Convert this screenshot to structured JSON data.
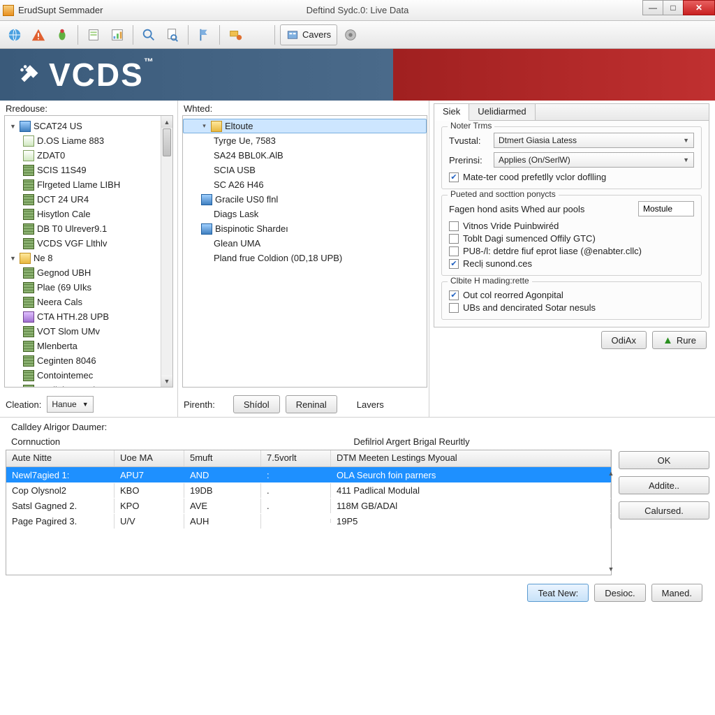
{
  "window": {
    "title_left": "ErudSupt Semmader",
    "title_center": "Deftind Sydc.0: Live Data"
  },
  "toolbar": {
    "cavers_label": "Cavers"
  },
  "banner": {
    "logo_text": "VCDS",
    "tm": "™"
  },
  "leftpane": {
    "label": "Rredouse:",
    "items": [
      {
        "icon": "blue",
        "exp": "▼",
        "text": "SCAT24 US"
      },
      {
        "icon": "doc",
        "text": "D.OS Liame 883"
      },
      {
        "icon": "doc",
        "text": "ZDAT0"
      },
      {
        "icon": "stack",
        "text": "SCIS 11S49"
      },
      {
        "icon": "stack",
        "text": "Flrgeted Llame LIBH"
      },
      {
        "icon": "stack",
        "text": "DCT 24 UR4"
      },
      {
        "icon": "stack",
        "text": "Hisytlon Cale"
      },
      {
        "icon": "stack",
        "text": "DB T0 Ulrever9.1"
      },
      {
        "icon": "stack",
        "text": "VCDS VGF Llthlv"
      },
      {
        "icon": "folder",
        "exp": "▼",
        "text": "Ne 8"
      },
      {
        "icon": "stack",
        "text": "Gegnod UBH"
      },
      {
        "icon": "stack",
        "text": "Plae (69 UIks"
      },
      {
        "icon": "stack",
        "text": "Neera Cals"
      },
      {
        "icon": "mix",
        "text": "CTA HTH.28 UPB"
      },
      {
        "icon": "stack",
        "text": "VOT Slom UMv"
      },
      {
        "icon": "stack",
        "text": "Mlenberta"
      },
      {
        "icon": "stack",
        "text": "Ceginten 8046"
      },
      {
        "icon": "stack",
        "text": "Contointemec"
      },
      {
        "icon": "stack",
        "text": "Appliaic Hettel"
      }
    ],
    "cleation_label": "Cleation:",
    "cleation_value": "Hanue"
  },
  "midpane": {
    "label": "Whted:",
    "items": [
      {
        "icon": "folder",
        "exp": "▾",
        "text": "Eltoute",
        "sel": true,
        "indent": "indent1"
      },
      {
        "text": "Tyrge Ue, 7583",
        "indent": "indent2"
      },
      {
        "text": "SA24 BBL0K.AlB",
        "indent": "indent2"
      },
      {
        "text": "SCIA USB",
        "indent": "indent2"
      },
      {
        "text": "SC A26 H46",
        "indent": "indent2"
      },
      {
        "icon": "blue",
        "text": "Gracile US0 flnl",
        "indent": "indent1"
      },
      {
        "text": "Diags Lask",
        "indent": "indent2"
      },
      {
        "icon": "blue",
        "text": "Bispinotic Shardeı",
        "indent": "indent1"
      },
      {
        "text": "Glean UMA",
        "indent": "indent2"
      },
      {
        "text": "Pland frue Coldion (0D,18 UPB)",
        "indent": "indent2"
      }
    ],
    "pirenth_label": "Pirenth:",
    "btn_shidol": "Shídol",
    "btn_reninal": "Reninal",
    "lavers_label": "Lavers"
  },
  "rightpane": {
    "tab1": "Siek",
    "tab2": "Uelidiarmed",
    "group1_legend": "Noter Trms",
    "tvustal_label": "Tvustal:",
    "tvustal_value": "Dtmert Giasia Latess",
    "prerinsi_label": "Prerinsi:",
    "prerinsi_value": "Applies (On/SerlW)",
    "chk_mate": "Mate-ter cood prefetlly vclor doflling",
    "group2_legend": "Pueted and socttion ponycts",
    "fagen_label": "Fagen hond asits Whed aur pools",
    "fagen_value": "Mostule",
    "chk_vitnos": "Vitnos Vride Puinbwiréd",
    "chk_tobit": "Toblt Dagi sumenced Offily GTC)",
    "chk_pu8": "PU8-/l: detdre fiuf eprot liase (@enabter.cllc)",
    "chk_recli": "Reclị sunond.ces",
    "group3_legend": "Clbite H mading:rette",
    "chk_out": "Out col reorred Agonpital",
    "chk_ubs": "UBs and dencirated Sotar nesuls",
    "btn_odiax": "OdiAx",
    "btn_rure": "Rure"
  },
  "bottom": {
    "label_left": "Calldey Alrigor Daumer:",
    "header_left": "Cornnuction",
    "header_center": "Defilriol Argert Brigal Reurltly",
    "cols": [
      "Aute Nitte",
      "Uoe MA",
      "5muft",
      "7.5vorlt",
      "DTM Meeten Lestings Myoual"
    ],
    "rows": [
      {
        "c0": "Newl7agied 1:",
        "c1": "APU7",
        "c2": "AND",
        "c3": ":",
        "c4": "OLA Seurch foin parners",
        "sel": true
      },
      {
        "c0": "Cop Olysnol2",
        "c1": "KBO",
        "c2": "19DB",
        "c3": ".",
        "c4": "411 Padlical Modulal"
      },
      {
        "c0": "Satsl Gagned 2.",
        "c1": "KPO",
        "c2": "AVE",
        "c3": ".",
        "c4": "118M GB/ADAl"
      },
      {
        "c0": "Page Pagired 3.",
        "c1": "U/V",
        "c2": "AUH",
        "c3": "",
        "c4": "19P5"
      }
    ],
    "btn_ok": "OK",
    "btn_addite": "Addite..",
    "btn_calursed": "Calursed."
  },
  "footer": {
    "btn_teat": "Teat New:",
    "btn_desioc": "Desioc.",
    "btn_maned": "Maned."
  }
}
